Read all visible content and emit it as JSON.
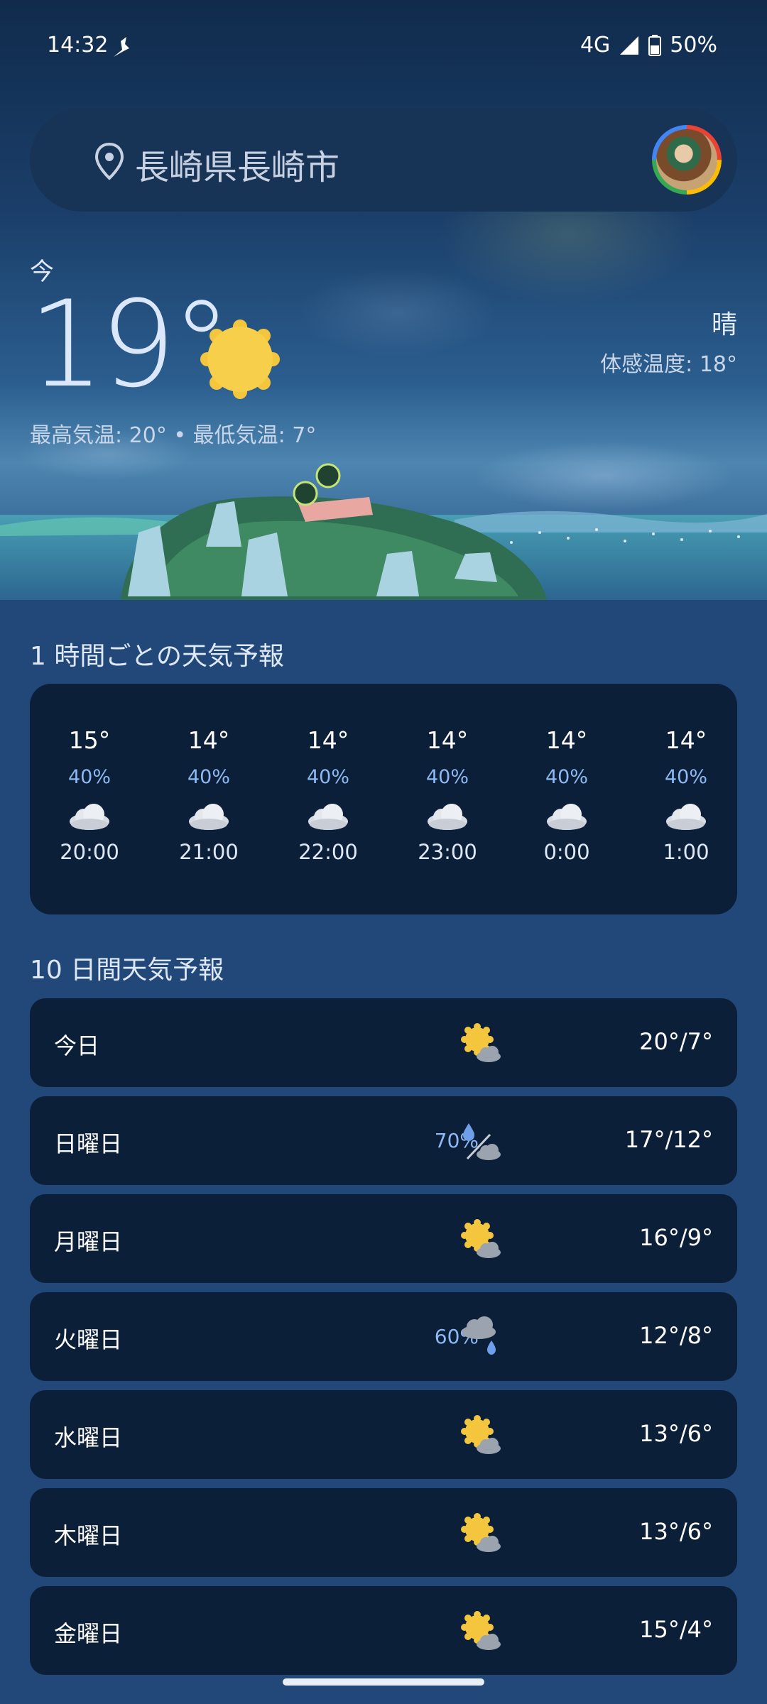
{
  "status_bar": {
    "time": "14:32",
    "network": "4G",
    "battery": "50%",
    "icons": [
      "notification-icon",
      "signal-icon",
      "battery-icon"
    ]
  },
  "search": {
    "location": "長崎県長崎市",
    "icon": "location-pin-icon"
  },
  "current": {
    "label": "今",
    "temperature": "19°",
    "condition": "晴",
    "feels_like": "体感温度: 18°",
    "high_low": "最高気温: 20° • 最低気温: 7°",
    "icon": "sunny-icon"
  },
  "hourly": {
    "title": "1 時間ごとの天気予報",
    "items": [
      {
        "temp": "15°",
        "precip": "40%",
        "time": "20:00",
        "icon": "cloudy-icon"
      },
      {
        "temp": "14°",
        "precip": "40%",
        "time": "21:00",
        "icon": "cloudy-icon"
      },
      {
        "temp": "14°",
        "precip": "40%",
        "time": "22:00",
        "icon": "cloudy-icon"
      },
      {
        "temp": "14°",
        "precip": "40%",
        "time": "23:00",
        "icon": "cloudy-icon"
      },
      {
        "temp": "14°",
        "precip": "40%",
        "time": "0:00",
        "icon": "cloudy-icon"
      },
      {
        "temp": "14°",
        "precip": "40%",
        "time": "1:00",
        "icon": "cloudy-icon"
      }
    ]
  },
  "daily": {
    "title": "10 日間天気予報",
    "items": [
      {
        "day": "今日",
        "precip": "",
        "temps": "20°/7°",
        "icon": "partly-sunny-icon"
      },
      {
        "day": "日曜日",
        "precip": "70%",
        "temps": "17°/12°",
        "icon": "rain-snow-mix-icon"
      },
      {
        "day": "月曜日",
        "precip": "",
        "temps": "16°/9°",
        "icon": "partly-sunny-icon"
      },
      {
        "day": "火曜日",
        "precip": "60%",
        "temps": "12°/8°",
        "icon": "cloud-rain-icon"
      },
      {
        "day": "水曜日",
        "precip": "",
        "temps": "13°/6°",
        "icon": "partly-sunny-icon"
      },
      {
        "day": "木曜日",
        "precip": "",
        "temps": "13°/6°",
        "icon": "partly-sunny-icon"
      },
      {
        "day": "金曜日",
        "precip": "",
        "temps": "15°/4°",
        "icon": "partly-sunny-icon"
      }
    ]
  },
  "colors": {
    "background": "#22487a",
    "card": "#0c1f38",
    "precip_text": "#8db8f2",
    "sun": "#f4c63d"
  }
}
